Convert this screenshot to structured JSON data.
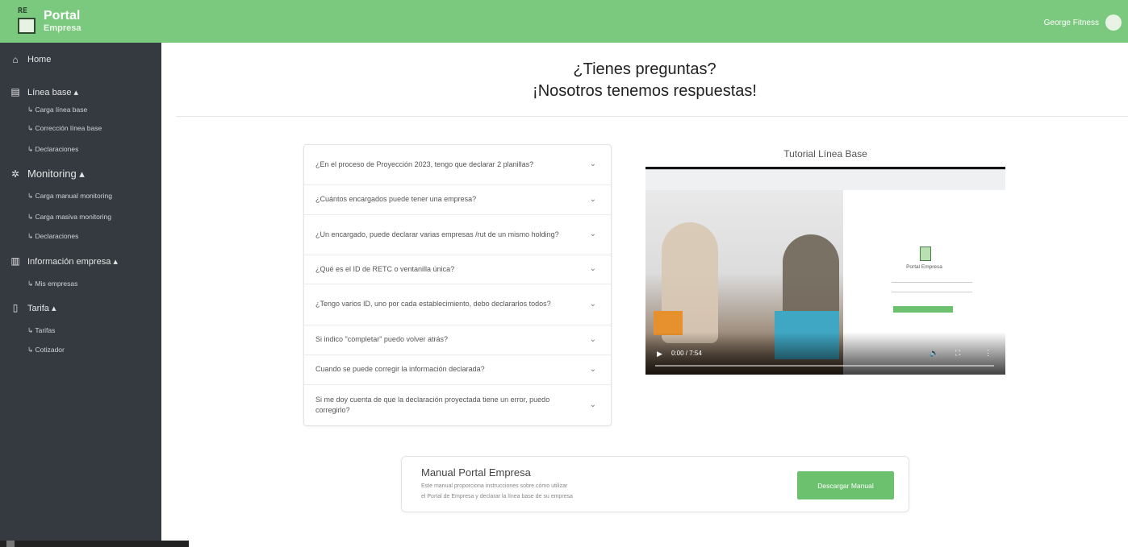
{
  "header": {
    "logo_line1": "Portal",
    "logo_line2": "Empresa",
    "logo_mark_text": "RE",
    "user_name": "George Fitness"
  },
  "sidebar": {
    "home": "Home",
    "linea_base": "Línea base ▴",
    "linea_base_items": [
      "Carga línea base",
      "Corrección línea base",
      "Declaraciones"
    ],
    "monitoring": "Monitoring ▴",
    "monitoring_items": [
      "Carga manual monitoring",
      "Carga masiva monitoring",
      "Declaraciones"
    ],
    "informacion": "Información empresa ▴",
    "informacion_items": [
      "Mis empresas"
    ],
    "tarifa": "Tarifa ▴",
    "tarifa_items": [
      "Tarifas",
      "Cotizador"
    ]
  },
  "main": {
    "title_line1": "¿Tienes preguntas?",
    "title_line2": "¡Nosotros tenemos respuestas!",
    "faq": [
      "¿En el proceso de Proyección 2023, tengo que declarar 2 planillas?",
      "¿Cuántos encargados puede tener una empresa?",
      "¿Un encargado, puede declarar varias empresas /rut de un mismo holding?",
      "¿Qué es el ID de RETC o ventanilla única?",
      "¿Tengo varios ID, uno por cada establecimiento, debo declararlos todos?",
      "Si indico \"completar\" puedo volver atrás?",
      "Cuando se puede corregir la información declarada?",
      "Si me doy cuenta de que la declaración proyectada tiene un error, puedo corregirlo?"
    ],
    "video_title": "Tutorial Línea Base",
    "video": {
      "time": "0:00 / 7:54",
      "progress": 0,
      "login_title": "Portal Empresa"
    },
    "manual": {
      "title": "Manual Portal Empresa",
      "desc_line1": "Este manual proporciona instrucciones sobre cómo utilizar",
      "desc_line2": "el Portal de Empresa y declarar la línea base de su empresa",
      "button": "Descargar Manual"
    }
  }
}
